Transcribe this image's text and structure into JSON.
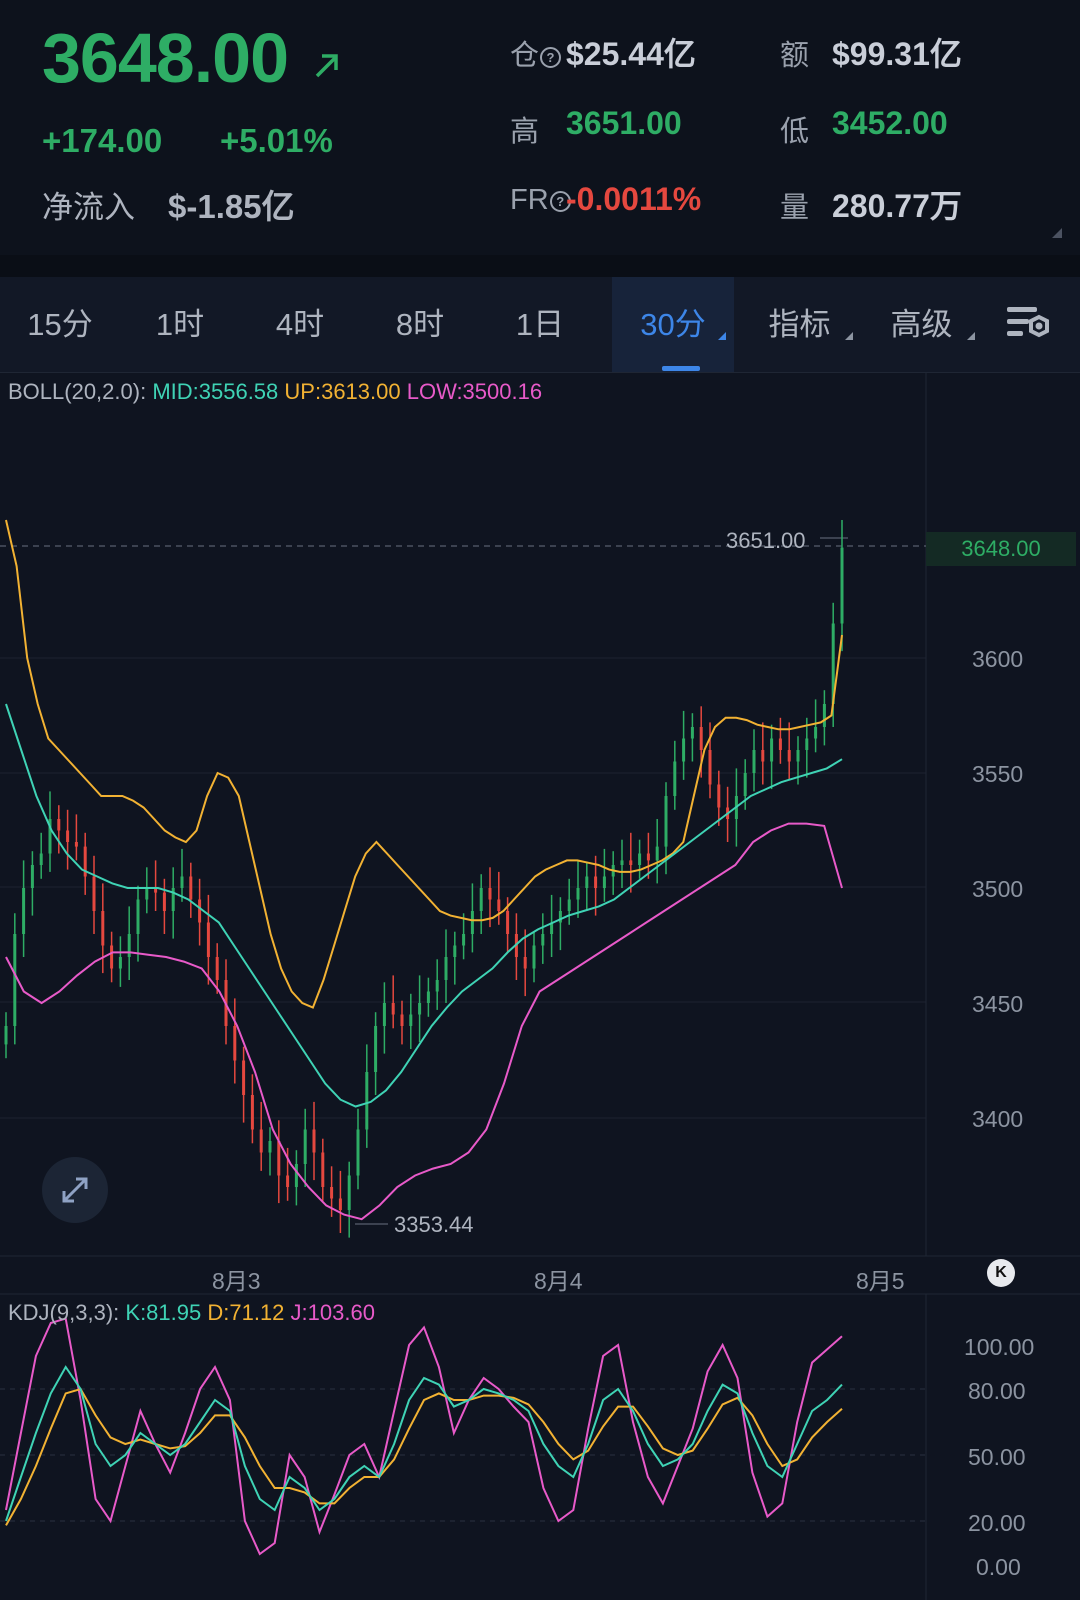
{
  "header": {
    "price": "3648.00",
    "change": "+174.00",
    "change_pct": "+5.01%",
    "net_inflow_label": "净流入",
    "net_inflow_value": "$-1.85亿",
    "stats": {
      "open_interest_label": "仓",
      "open_interest_value": "$25.44亿",
      "amount_label": "额",
      "amount_value": "$99.31亿",
      "high_label": "高",
      "high_value": "3651.00",
      "low_label": "低",
      "low_value": "3452.00",
      "funding_label": "FR",
      "funding_value": "-0.0011%",
      "volume_label": "量",
      "volume_value": "280.77万"
    },
    "colors": {
      "up": "#2ead65",
      "down": "#e5483f"
    }
  },
  "tabs": [
    {
      "label": "15分"
    },
    {
      "label": "1时"
    },
    {
      "label": "4时"
    },
    {
      "label": "8时"
    },
    {
      "label": "1日"
    },
    {
      "label": "30分",
      "active": true
    },
    {
      "label": "指标"
    },
    {
      "label": "高级"
    }
  ],
  "boll_legend": {
    "name": "BOLL(20,2.0):",
    "mid": "MID:3556.58",
    "up": "UP:3613.00",
    "low": "LOW:3500.16",
    "colors": {
      "mid": "#3fd3b5",
      "up": "#f2b233",
      "low": "#e85ac9"
    }
  },
  "kdj_legend": {
    "name": "KDJ(9,3,3):",
    "k": "K:81.95",
    "d": "D:71.12",
    "j": "J:103.60"
  },
  "chart_data": [
    {
      "type": "candlestick",
      "yaxis_ticks": [
        "3600",
        "3550",
        "3500",
        "3450",
        "3400"
      ],
      "ylim": [
        3335,
        3695
      ],
      "x_ticks": [
        "8月3",
        "8月4",
        "8月5"
      ],
      "current_price": "3648.00",
      "high_marker": "3651.00",
      "low_marker": "3353.44",
      "candle_closes": [
        3440,
        3480,
        3500,
        3510,
        3515,
        3530,
        3525,
        3520,
        3518,
        3505,
        3490,
        3475,
        3465,
        3470,
        3480,
        3495,
        3500,
        3498,
        3490,
        3500,
        3505,
        3495,
        3485,
        3470,
        3460,
        3440,
        3425,
        3410,
        3395,
        3385,
        3390,
        3375,
        3370,
        3380,
        3395,
        3385,
        3370,
        3365,
        3360,
        3375,
        3395,
        3420,
        3440,
        3450,
        3445,
        3440,
        3445,
        3450,
        3455,
        3460,
        3470,
        3475,
        3480,
        3490,
        3500,
        3495,
        3490,
        3480,
        3470,
        3465,
        3475,
        3480,
        3485,
        3490,
        3495,
        3500,
        3505,
        3500,
        3505,
        3510,
        3512,
        3510,
        3515,
        3512,
        3518,
        3540,
        3555,
        3565,
        3570,
        3560,
        3545,
        3535,
        3530,
        3540,
        3550,
        3560,
        3555,
        3565,
        3560,
        3555,
        3560,
        3565,
        3570,
        3580,
        3615,
        3648
      ],
      "boll_up": [
        3660,
        3640,
        3600,
        3580,
        3565,
        3560,
        3555,
        3550,
        3545,
        3540,
        3540,
        3540,
        3538,
        3535,
        3530,
        3525,
        3522,
        3520,
        3525,
        3540,
        3550,
        3548,
        3540,
        3520,
        3500,
        3480,
        3465,
        3455,
        3450,
        3448,
        3460,
        3475,
        3490,
        3505,
        3515,
        3520,
        3515,
        3510,
        3505,
        3500,
        3495,
        3490,
        3488,
        3487,
        3486,
        3486,
        3487,
        3490,
        3495,
        3500,
        3505,
        3508,
        3510,
        3512,
        3512,
        3511,
        3510,
        3508,
        3507,
        3507,
        3508,
        3510,
        3512,
        3515,
        3520,
        3540,
        3560,
        3570,
        3574,
        3574,
        3573,
        3571,
        3570,
        3569,
        3569,
        3570,
        3571,
        3572,
        3575,
        3610
      ],
      "boll_mid": [
        3580,
        3560,
        3540,
        3525,
        3515,
        3508,
        3505,
        3502,
        3500,
        3500,
        3500,
        3498,
        3495,
        3490,
        3485,
        3475,
        3465,
        3455,
        3445,
        3435,
        3425,
        3415,
        3408,
        3405,
        3407,
        3412,
        3420,
        3430,
        3440,
        3448,
        3455,
        3460,
        3465,
        3472,
        3478,
        3482,
        3485,
        3488,
        3490,
        3492,
        3495,
        3500,
        3505,
        3510,
        3515,
        3520,
        3525,
        3530,
        3535,
        3540,
        3543,
        3546,
        3548,
        3550,
        3552,
        3556
      ],
      "boll_low": [
        3470,
        3455,
        3450,
        3455,
        3462,
        3468,
        3472,
        3472,
        3471,
        3470,
        3468,
        3465,
        3455,
        3440,
        3420,
        3395,
        3380,
        3370,
        3362,
        3358,
        3356,
        3362,
        3370,
        3375,
        3378,
        3380,
        3385,
        3395,
        3415,
        3440,
        3455,
        3460,
        3465,
        3470,
        3475,
        3480,
        3485,
        3490,
        3495,
        3500,
        3505,
        3510,
        3520,
        3525,
        3528,
        3528,
        3527,
        3500
      ]
    },
    {
      "type": "line",
      "name": "KDJ",
      "yaxis_ticks": [
        "100.00",
        "80.00",
        "50.00",
        "20.00",
        "0.00"
      ],
      "ylim": [
        0,
        100
      ],
      "k": [
        20,
        40,
        60,
        78,
        90,
        80,
        55,
        45,
        50,
        60,
        55,
        50,
        55,
        65,
        75,
        70,
        45,
        30,
        25,
        40,
        35,
        25,
        30,
        40,
        45,
        40,
        55,
        75,
        85,
        82,
        72,
        75,
        80,
        78,
        75,
        70,
        55,
        45,
        40,
        55,
        75,
        80,
        70,
        55,
        45,
        48,
        55,
        70,
        82,
        78,
        60,
        45,
        40,
        55,
        70,
        75,
        82
      ],
      "d": [
        18,
        30,
        45,
        62,
        78,
        80,
        68,
        58,
        55,
        57,
        55,
        53,
        54,
        60,
        68,
        68,
        58,
        45,
        35,
        35,
        33,
        28,
        28,
        35,
        40,
        40,
        48,
        62,
        75,
        78,
        75,
        75,
        77,
        77,
        76,
        73,
        65,
        55,
        48,
        52,
        63,
        72,
        72,
        63,
        53,
        50,
        52,
        62,
        73,
        76,
        68,
        55,
        45,
        48,
        58,
        65,
        71
      ],
      "j": [
        25,
        60,
        95,
        110,
        112,
        75,
        30,
        20,
        45,
        70,
        55,
        42,
        60,
        80,
        90,
        75,
        20,
        5,
        10,
        50,
        40,
        15,
        32,
        50,
        55,
        40,
        70,
        100,
        108,
        90,
        60,
        75,
        85,
        80,
        72,
        65,
        35,
        20,
        25,
        62,
        95,
        100,
        65,
        40,
        28,
        45,
        62,
        88,
        100,
        85,
        42,
        22,
        28,
        65,
        92,
        98,
        104
      ]
    }
  ]
}
